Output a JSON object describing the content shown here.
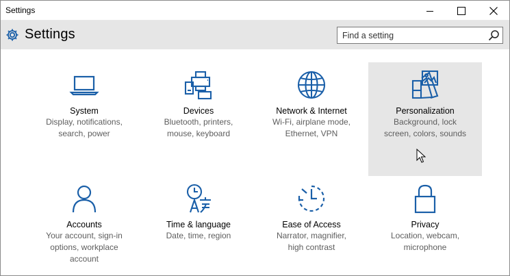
{
  "window": {
    "title": "Settings",
    "controls": [
      "minimize-icon",
      "maximize-icon",
      "close-icon"
    ]
  },
  "header": {
    "title": "Settings",
    "icon": "gear-icon"
  },
  "search": {
    "placeholder": "Find a setting",
    "value": "",
    "icon": "search-icon"
  },
  "accent_color": "#1a5fa8",
  "tiles": [
    {
      "name": "System",
      "desc1": "Display, notifications,",
      "desc2": "search, power",
      "desc3": "",
      "icon": "laptop-icon"
    },
    {
      "name": "Devices",
      "desc1": "Bluetooth, printers,",
      "desc2": "mouse, keyboard",
      "desc3": "",
      "icon": "devices-icon"
    },
    {
      "name": "Network & Internet",
      "desc1": "Wi-Fi, airplane mode,",
      "desc2": "Ethernet, VPN",
      "desc3": "",
      "icon": "globe-icon"
    },
    {
      "name": "Personalization",
      "desc1": "Background, lock",
      "desc2": "screen, colors, sounds",
      "desc3": "",
      "icon": "personalization-icon",
      "hovered": true
    },
    {
      "name": "Accounts",
      "desc1": "Your account, sign-in",
      "desc2": "options, workplace",
      "desc3": "account",
      "icon": "person-icon"
    },
    {
      "name": "Time & language",
      "desc1": "Date, time, region",
      "desc2": "",
      "desc3": "",
      "icon": "time-language-icon"
    },
    {
      "name": "Ease of Access",
      "desc1": "Narrator, magnifier,",
      "desc2": "high contrast",
      "desc3": "",
      "icon": "ease-of-access-icon"
    },
    {
      "name": "Privacy",
      "desc1": "Location, webcam,",
      "desc2": "microphone",
      "desc3": "",
      "icon": "lock-icon"
    }
  ]
}
